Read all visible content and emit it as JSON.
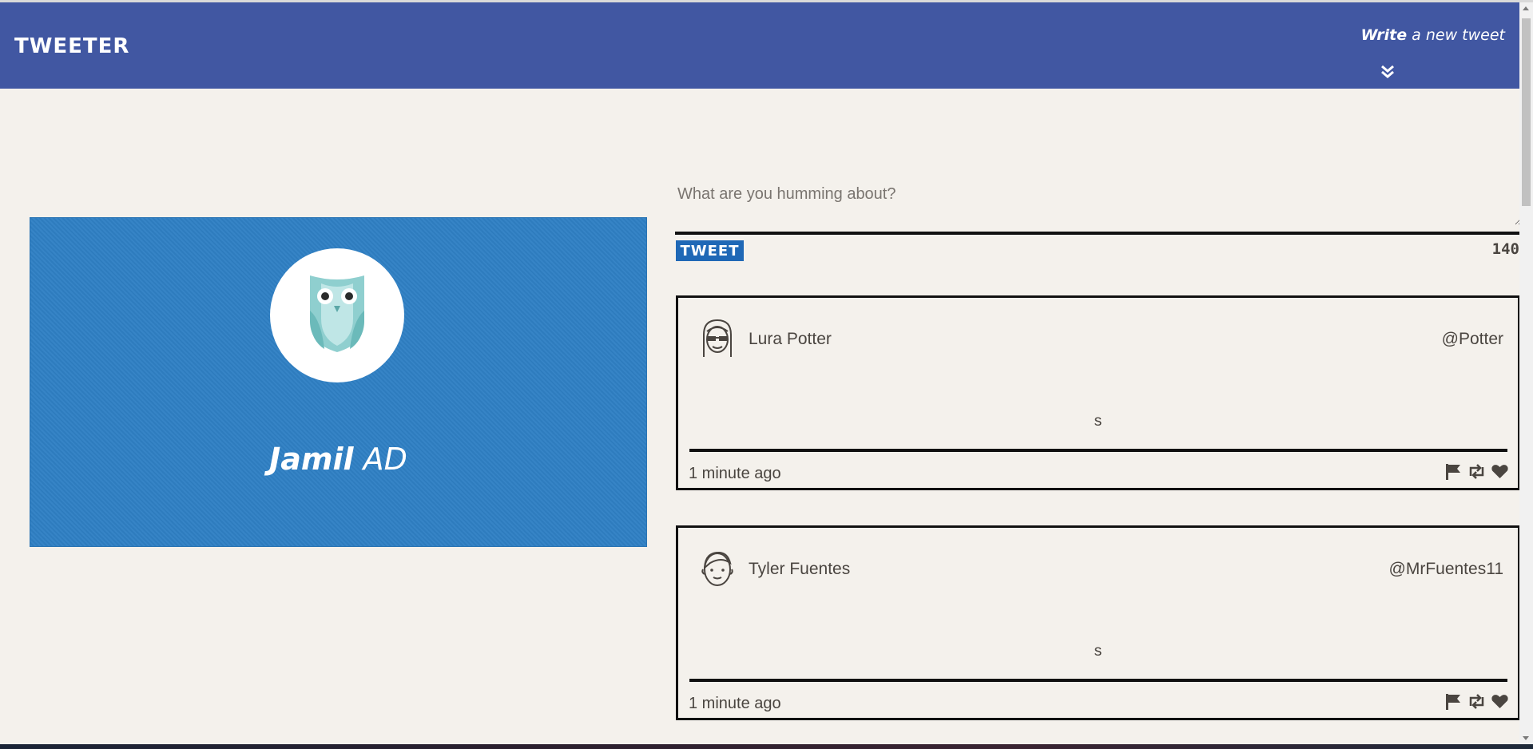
{
  "nav": {
    "brand": "TWEETER",
    "compose_prefix": "Write",
    "compose_suffix": " a new tweet",
    "compose_icon": "double-chevron-down-icon"
  },
  "profile": {
    "first_name": "Jamil",
    "last_name": " AD",
    "avatar": "owl-avatar",
    "background_color": "#2f80c4"
  },
  "composer": {
    "placeholder": "What are you humming about?",
    "value": "",
    "submit_label": "TWEET",
    "char_count": "140"
  },
  "tweets": [
    {
      "name": "Lura Potter",
      "handle": "@Potter",
      "body": "s",
      "time": "1 minute ago",
      "avatar": "woman-sunglasses-avatar",
      "actions": [
        "flag-icon",
        "retweet-icon",
        "heart-icon"
      ]
    },
    {
      "name": "Tyler Fuentes",
      "handle": "@MrFuentes11",
      "body": "s",
      "time": "1 minute ago",
      "avatar": "man-avatar",
      "actions": [
        "flag-icon",
        "retweet-icon",
        "heart-icon"
      ]
    }
  ],
  "colors": {
    "navbar": "#4157a2",
    "page_background": "#f4f1ec",
    "tweet_button": "#1f68b6",
    "text": "#4a4540"
  }
}
